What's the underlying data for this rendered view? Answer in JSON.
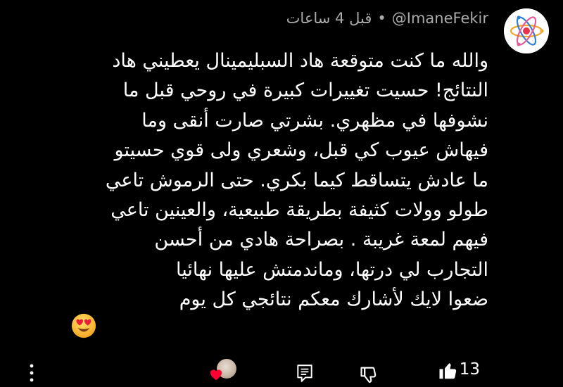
{
  "comment": {
    "author": "@ImaneFekir",
    "separator": "•",
    "time": "قبل 4 ساعات",
    "text": "والله ما كنت متوقعة هاد السبليمينال يعطيني هاد\nالنتائج! حسيت تغييرات كبيرة في روحي قبل ما\nنشوفها في مظهري. بشرتي صارت أنقى وما\nفيهاش عيوب كي قبل، وشعري ولى قوي حسيتو\nما عادش يتساقط كيما بكري. حتى الرموش تاعي\nطولو وولات كثيفة بطريقة طبيعية، والعينين تاعي\nفيهم لمعة غريبة . بصراحة هادي من أحسن\nالتجارب لي درتها، وماندمتش عليها نهائيا\nضعوا لايك لأشارك معكم نتائجي كل يوم",
    "emoji": "heart-eyes-face-emoji",
    "like_count": "13"
  },
  "icons": {
    "avatar": "atom-logo-icon",
    "like": "thumbs-up-icon",
    "dislike": "thumbs-down-icon",
    "reply": "reply-comment-icon",
    "creator_heart": "creator-heart-icon",
    "menu": "more-vertical-icon"
  },
  "colors": {
    "background": "#000000",
    "text": "#ffffff",
    "meta": "#aaaaaa",
    "heart": "#ff0033",
    "atom_orange": "#f4a62a",
    "atom_red": "#e8344a",
    "atom_blue": "#2f80d1",
    "atom_pink": "#e25a9b"
  }
}
